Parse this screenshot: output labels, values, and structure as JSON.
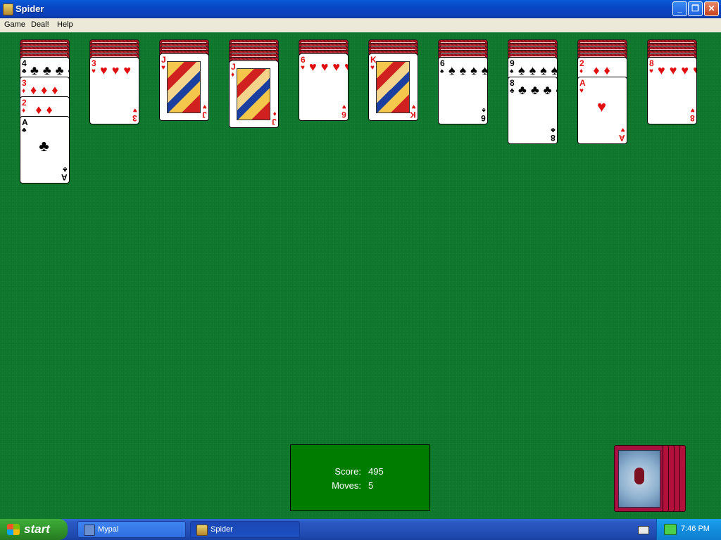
{
  "window": {
    "title": "Spider"
  },
  "menu": [
    "Game",
    "Deal!",
    "Help"
  ],
  "colors": {
    "felt": "#0f7a2e",
    "card_back": "#b81c28",
    "score_box": "#007c00",
    "red_suit": "#e01010"
  },
  "tableau": [
    {
      "column": 1,
      "face_down": 5,
      "face_up": [
        {
          "rank": "4",
          "suit": "♣"
        },
        {
          "rank": "3",
          "suit": "♦"
        },
        {
          "rank": "2",
          "suit": "♦"
        },
        {
          "rank": "A",
          "suit": "♣"
        }
      ]
    },
    {
      "column": 2,
      "face_down": 5,
      "face_up": [
        {
          "rank": "3",
          "suit": "♥"
        }
      ]
    },
    {
      "column": 3,
      "face_down": 4,
      "face_up": [
        {
          "rank": "J",
          "suit": "♥"
        }
      ]
    },
    {
      "column": 4,
      "face_down": 6,
      "face_up": [
        {
          "rank": "J",
          "suit": "♦"
        }
      ]
    },
    {
      "column": 5,
      "face_down": 4,
      "face_up": [
        {
          "rank": "6",
          "suit": "♥"
        }
      ]
    },
    {
      "column": 6,
      "face_down": 4,
      "face_up": [
        {
          "rank": "K",
          "suit": "♥"
        }
      ]
    },
    {
      "column": 7,
      "face_down": 5,
      "face_up": [
        {
          "rank": "6",
          "suit": "♠"
        }
      ]
    },
    {
      "column": 8,
      "face_down": 5,
      "face_up": [
        {
          "rank": "9",
          "suit": "♠"
        },
        {
          "rank": "8",
          "suit": "♣"
        }
      ]
    },
    {
      "column": 9,
      "face_down": 5,
      "face_up": [
        {
          "rank": "2",
          "suit": "♦"
        },
        {
          "rank": "A",
          "suit": "♥"
        }
      ]
    },
    {
      "column": 10,
      "face_down": 5,
      "face_up": [
        {
          "rank": "8",
          "suit": "♥"
        }
      ]
    }
  ],
  "score": {
    "score_label": "Score:",
    "score_value": "495",
    "moves_label": "Moves:",
    "moves_value": "5"
  },
  "stock": {
    "piles_remaining": 5
  },
  "taskbar": {
    "start_label": "start",
    "tasks": [
      {
        "label": "Mypal"
      },
      {
        "label": "Spider"
      }
    ],
    "clock": "7:46 PM"
  }
}
